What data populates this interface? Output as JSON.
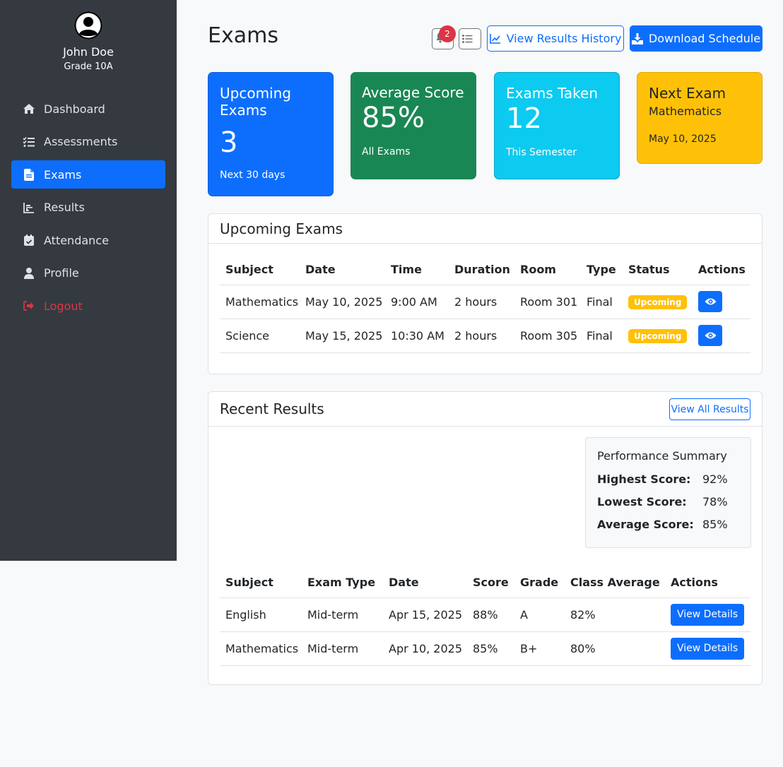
{
  "sidebar": {
    "user_name": "John Doe",
    "user_grade": "Grade 10A",
    "items": [
      {
        "label": "Dashboard",
        "icon": "home-icon"
      },
      {
        "label": "Assessments",
        "icon": "tasks-icon"
      },
      {
        "label": "Exams",
        "icon": "file-icon",
        "active": true
      },
      {
        "label": "Results",
        "icon": "chart-icon"
      },
      {
        "label": "Attendance",
        "icon": "calendar-check-icon"
      },
      {
        "label": "Profile",
        "icon": "user-icon"
      },
      {
        "label": "Logout",
        "icon": "sign-out-icon"
      }
    ]
  },
  "header": {
    "title": "Exams",
    "notification_count": "2",
    "history_label": "View Results History",
    "download_label": "Download Schedule"
  },
  "stats": {
    "upcoming": {
      "title": "Upcoming Exams",
      "value": "3",
      "sub": "Next 30 days"
    },
    "average": {
      "title": "Average Score",
      "value": "85%",
      "sub": "All Exams"
    },
    "taken": {
      "title": "Exams Taken",
      "value": "12",
      "sub": "This Semester"
    },
    "next": {
      "title": "Next Exam",
      "subject": "Mathematics",
      "date": "May 10, 2025"
    }
  },
  "upcoming_exams": {
    "title": "Upcoming Exams",
    "columns": [
      "Subject",
      "Date",
      "Time",
      "Duration",
      "Room",
      "Type",
      "Status",
      "Actions"
    ],
    "rows": [
      {
        "subject": "Mathematics",
        "date": "May 10, 2025",
        "time": "9:00 AM",
        "duration": "2 hours",
        "room": "Room 301",
        "type": "Final",
        "status": "Upcoming"
      },
      {
        "subject": "Science",
        "date": "May 15, 2025",
        "time": "10:30 AM",
        "duration": "2 hours",
        "room": "Room 305",
        "type": "Final",
        "status": "Upcoming"
      }
    ]
  },
  "recent_results": {
    "title": "Recent Results",
    "view_all_label": "View All Results",
    "summary": {
      "title": "Performance Summary",
      "highest_label": "Highest Score:",
      "highest": "92%",
      "lowest_label": "Lowest Score:",
      "lowest": "78%",
      "average_label": "Average Score:",
      "average": "85%"
    },
    "columns": [
      "Subject",
      "Exam Type",
      "Date",
      "Score",
      "Grade",
      "Class Average",
      "Actions"
    ],
    "rows": [
      {
        "subject": "English",
        "exam_type": "Mid-term",
        "date": "Apr 15, 2025",
        "score": "88%",
        "grade": "A",
        "class_avg": "82%",
        "action": "View Details"
      },
      {
        "subject": "Mathematics",
        "exam_type": "Mid-term",
        "date": "Apr 10, 2025",
        "score": "85%",
        "grade": "B+",
        "class_avg": "80%",
        "action": "View Details"
      }
    ]
  },
  "colors": {
    "primary": "#0d6efd",
    "success": "#198754",
    "info": "#0dcaf0",
    "warning": "#ffc107",
    "danger": "#dc3545",
    "sidebar": "#343a40"
  }
}
